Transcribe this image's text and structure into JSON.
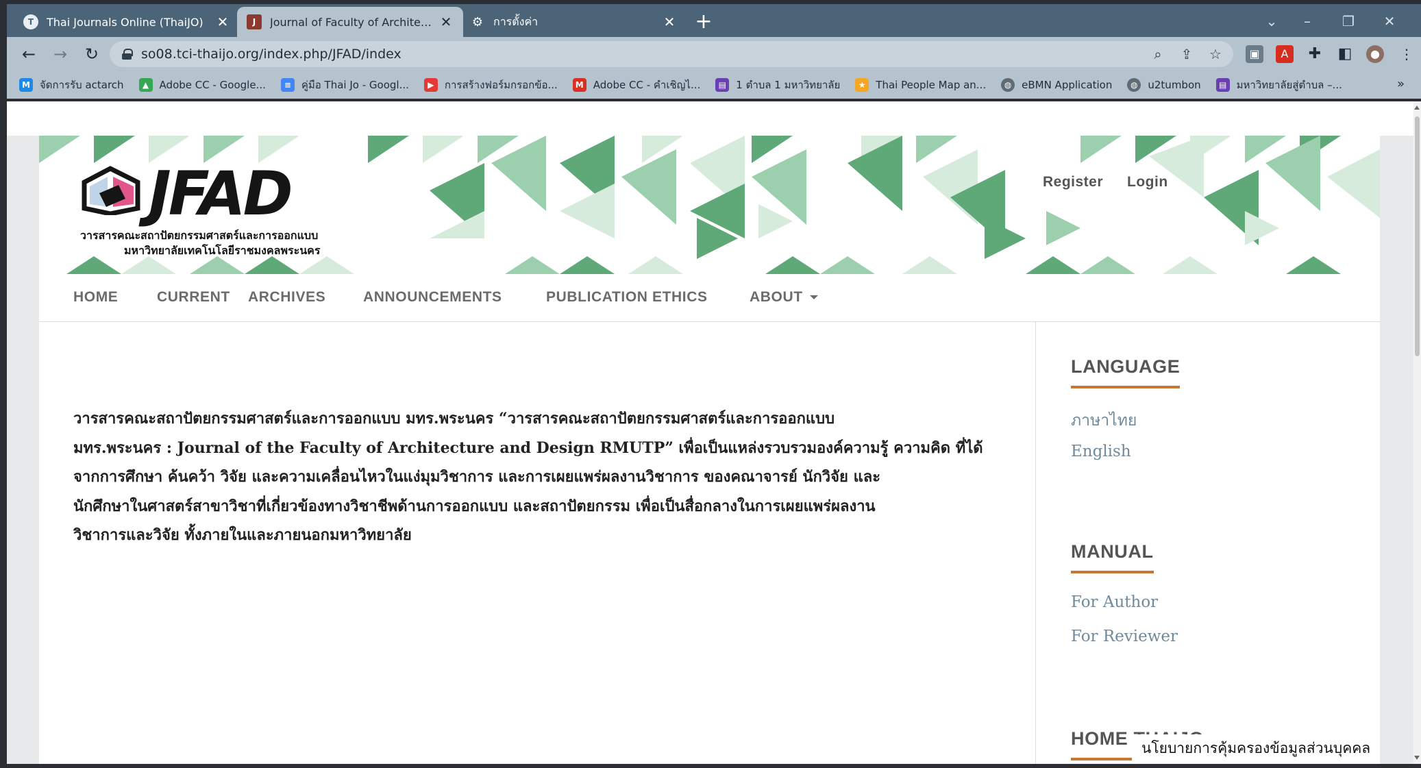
{
  "browser": {
    "tabs": [
      {
        "label": "Thai Journals Online (ThaiJO)",
        "icon": "thaijo-icon",
        "active": false
      },
      {
        "label": "Journal of Faculty of Architecture",
        "icon": "jfad-icon",
        "active": true
      },
      {
        "label": "การตั้งค่า",
        "icon": "gear-icon",
        "active": false
      }
    ],
    "new_tab": "+",
    "url": "so08.tci-thaijo.org/index.php/JFAD/index",
    "bookmarks": [
      {
        "label": "จัดการรับ actarch",
        "icon": "m-logo-icon",
        "color": "#1e88e5"
      },
      {
        "label": "Adobe CC - Google...",
        "icon": "google-drive-icon",
        "color": "#34a853"
      },
      {
        "label": "คู่มือ Thai Jo - Googl...",
        "icon": "google-docs-icon",
        "color": "#4285f4"
      },
      {
        "label": "การสร้างฟอร์มกรอกข้อ...",
        "icon": "youtube-icon",
        "color": "#e53935"
      },
      {
        "label": "Adobe CC - คำเชิญไ...",
        "icon": "gmail-icon",
        "color": "#d93025"
      },
      {
        "label": "1 ตำบล 1 มหาวิทยาลัย",
        "icon": "bookmark-page-icon",
        "color": "#6a3fb5"
      },
      {
        "label": "Thai People Map an...",
        "icon": "star-person-icon",
        "color": "#f5a623"
      },
      {
        "label": "eBMN Application",
        "icon": "globe-icon",
        "color": "#5f6b75"
      },
      {
        "label": "u2tumbon",
        "icon": "globe-icon",
        "color": "#5f6b75"
      },
      {
        "label": "มหาวิทยาลัยสู่ตำบล –...",
        "icon": "bookmark-page-icon",
        "color": "#6a3fb5"
      }
    ],
    "bookmarks_more": "»"
  },
  "site": {
    "logo_word": "JFAD",
    "logo_thai_line1": "วารสารคณะสถาปัตยกรรมศาสตร์และการออกแบบ",
    "logo_thai_line2": "มหาวิทยาลัยเทคโนโลยีราชมงคลพระนคร",
    "register": "Register",
    "login": "Login",
    "nav": [
      {
        "label": "HOME"
      },
      {
        "label": "CURRENT"
      },
      {
        "label": "ARCHIVES"
      },
      {
        "label": "ANNOUNCEMENTS"
      },
      {
        "label": "PUBLICATION ETHICS"
      },
      {
        "label": "ABOUT"
      }
    ],
    "banner_colors": {
      "dark": "#5fa877",
      "mid": "#9ccfae",
      "light": "#d7ebdd"
    }
  },
  "main": {
    "intro_lines": [
      "วารสารคณะสถาปัตยกรรมศาสตร์และการออกแบบ มทร.พระนคร “วารสารคณะสถาปัตยกรรมศาสตร์และการออกแบบ",
      "มทร.พระนคร : Journal of the Faculty of Architecture and Design RMUTP” เพื่อเป็นแหล่งรวบรวมองค์ความรู้ ความคิด ที่ได้",
      "จากการศึกษา ค้นคว้า วิจัย และความเคลื่อนไหวในแง่มุมวิชาการ และการเผยแพร่ผลงานวิชาการ ของคณาจารย์ นักวิจัย และ",
      "นักศึกษาในศาสตร์สาขาวิชาที่เกี่ยวข้องทางวิชาชีพด้านการออกแบบ และสถาปัตยกรรม เพื่อเป็นสื่อกลางในการเผยแพร่ผลงาน",
      "วิชาการและวิจัย ทั้งภายในและภายนอกมหาวิทยาลัย"
    ]
  },
  "sidebar": {
    "language_title": "LANGUAGE",
    "languages": [
      "ภาษาไทย",
      "English"
    ],
    "manual_title": "MANUAL",
    "manuals": [
      "For Author",
      "For Reviewer"
    ],
    "home_title": "HOME THAIJO"
  },
  "privacy_notice": "นโยบายการคุ้มครองข้อมูลส่วนบุคคล"
}
